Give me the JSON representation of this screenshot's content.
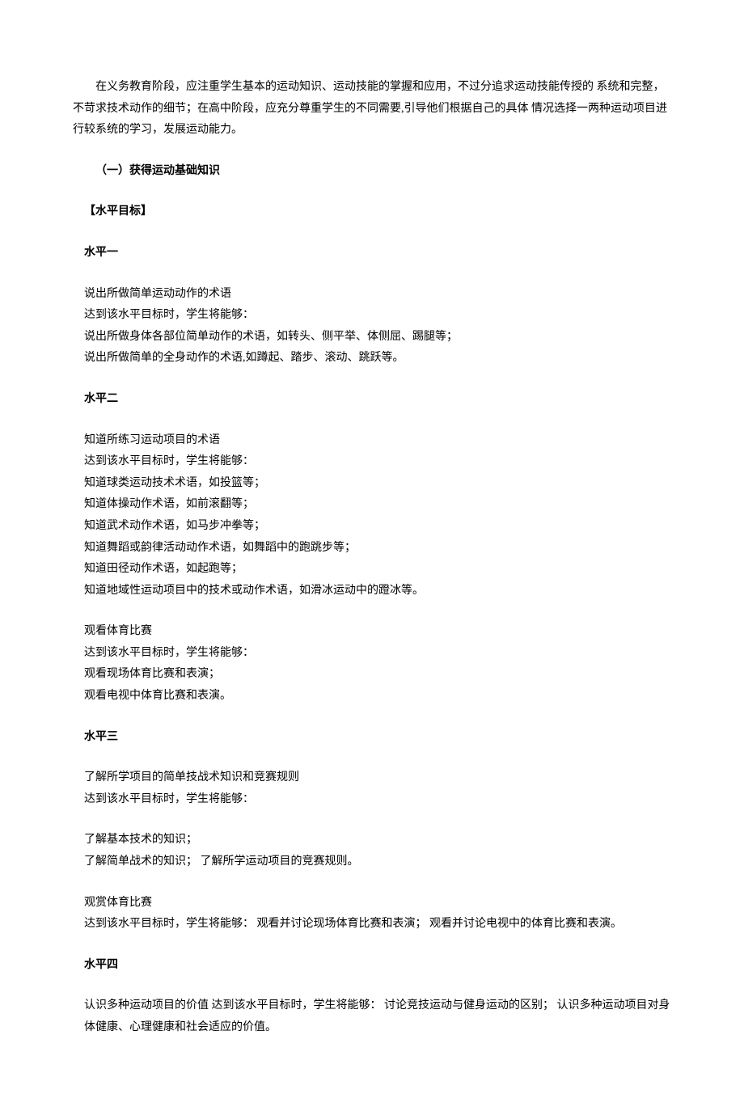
{
  "intro": "在义务教育阶段，应注重学生基本的运动知识、运动技能的掌握和应用，不过分追求运动技能传授的  系统和完整，不苛求技术动作的细节；在高中阶段，应充分尊重学生的不同需要,引导他们根据自己的具体 情况选择一两种运动项目进行较系统的学习，发展运动能力。",
  "section_title": "（一）获得运动基础知识",
  "sub_header": "【水平目标】",
  "level1": {
    "title": "水平一",
    "lines": [
      "说出所做简单运动动作的术语",
      "达到该水平目标时，学生将能够：",
      "说出所做身体各部位简单动作的术语，如转头、侧平举、体侧屈、踢腿等；",
      "说出所做简单的全身动作的术语,如蹲起、踏步、滚动、跳跃等。"
    ]
  },
  "level2": {
    "title": "水平二",
    "block1": [
      "知道所练习运动项目的术语",
      "达到该水平目标时，学生将能够：",
      "知道球类运动技术术语，如投篮等；",
      "知道体操动作术语，如前滚翻等；",
      "知道武术动作术语，如马步冲拳等；",
      "知道舞蹈或韵律活动动作术语，如舞蹈中的跑跳步等；",
      "知道田径动作术语，如起跑等；",
      "知道地域性运动项目中的技术或动作术语，如滑冰运动中的蹬冰等。"
    ],
    "block2": [
      "观看体育比赛",
      "达到该水平目标时，学生将能够：",
      "观看现场体育比赛和表演；",
      "观看电视中体育比赛和表演。"
    ]
  },
  "level3": {
    "title": "水平三",
    "block1": [
      "了解所学项目的简单技战术知识和竞赛规则",
      "达到该水平目标时，学生将能够："
    ],
    "block2": [
      "了解基本技术的知识；",
      "了解简单战术的知识；  了解所学运动项目的竞赛规则。"
    ],
    "block3": [
      "观赏体育比赛",
      "达到该水平目标时，学生将能够：  观看并讨论现场体育比赛和表演；  观看并讨论电视中的体育比赛和表演。"
    ]
  },
  "level4": {
    "title": "水平四",
    "block1": [
      "认识多种运动项目的价值  达到该水平目标时，学生将能够：  讨论竞技运动与健身运动的区别；  认识多种运动项目对身体健康、心理健康和社会适应的价值。"
    ]
  }
}
